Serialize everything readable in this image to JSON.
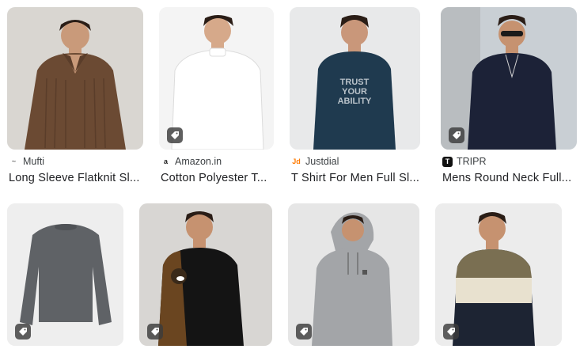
{
  "results": [
    {
      "source": "Mufti",
      "title": "Long Sleeve Flatknit Sl...",
      "logo": "mufti-wave-icon",
      "logo_text": "~",
      "logo_color": "#6d6d6d",
      "logo_bg": "#ffffff",
      "shirt_color": "#6b4a33",
      "bg_color": "#d9d6d1",
      "has_tag": false
    },
    {
      "source": "Amazon.in",
      "title": "Cotton Polyester T...",
      "logo": "amazon-icon",
      "logo_text": "a",
      "logo_color": "#1a1a1a",
      "logo_bg": "#ffffff",
      "shirt_color": "#f3f3f3",
      "bg_color": "#f4f4f4",
      "has_tag": true
    },
    {
      "source": "Justdial",
      "title": "T Shirt For Men Full Sl...",
      "logo": "justdial-icon",
      "logo_text": "Jd",
      "logo_color": "#ff7a00",
      "logo_bg": "#ffffff",
      "shirt_color": "#1f3a4f",
      "bg_color": "#e8e9ea",
      "has_tag": false,
      "shirt_text": "TRUST YOUR ABILITY"
    },
    {
      "source": "TRIPR",
      "title": "Mens Round Neck Full...",
      "logo": "tripr-icon",
      "logo_text": "T",
      "logo_color": "#ffffff",
      "logo_bg": "#111111",
      "shirt_color": "#1c2237",
      "bg_color": "#c9cfd4",
      "has_tag": true
    },
    {
      "source": "",
      "title": "",
      "shirt_color": "#5f6266",
      "bg_color": "#eeeeee",
      "has_tag": true
    },
    {
      "source": "",
      "title": "",
      "shirt_color": "#141414",
      "bg_color": "#d8d6d3",
      "has_tag": true
    },
    {
      "source": "",
      "title": "",
      "shirt_color": "#a3a5a8",
      "bg_color": "#e6e6e6",
      "has_tag": true
    },
    {
      "source": "",
      "title": "",
      "shirt_color": "#1d2433",
      "bg_color": "#ececec",
      "has_tag": true
    }
  ]
}
